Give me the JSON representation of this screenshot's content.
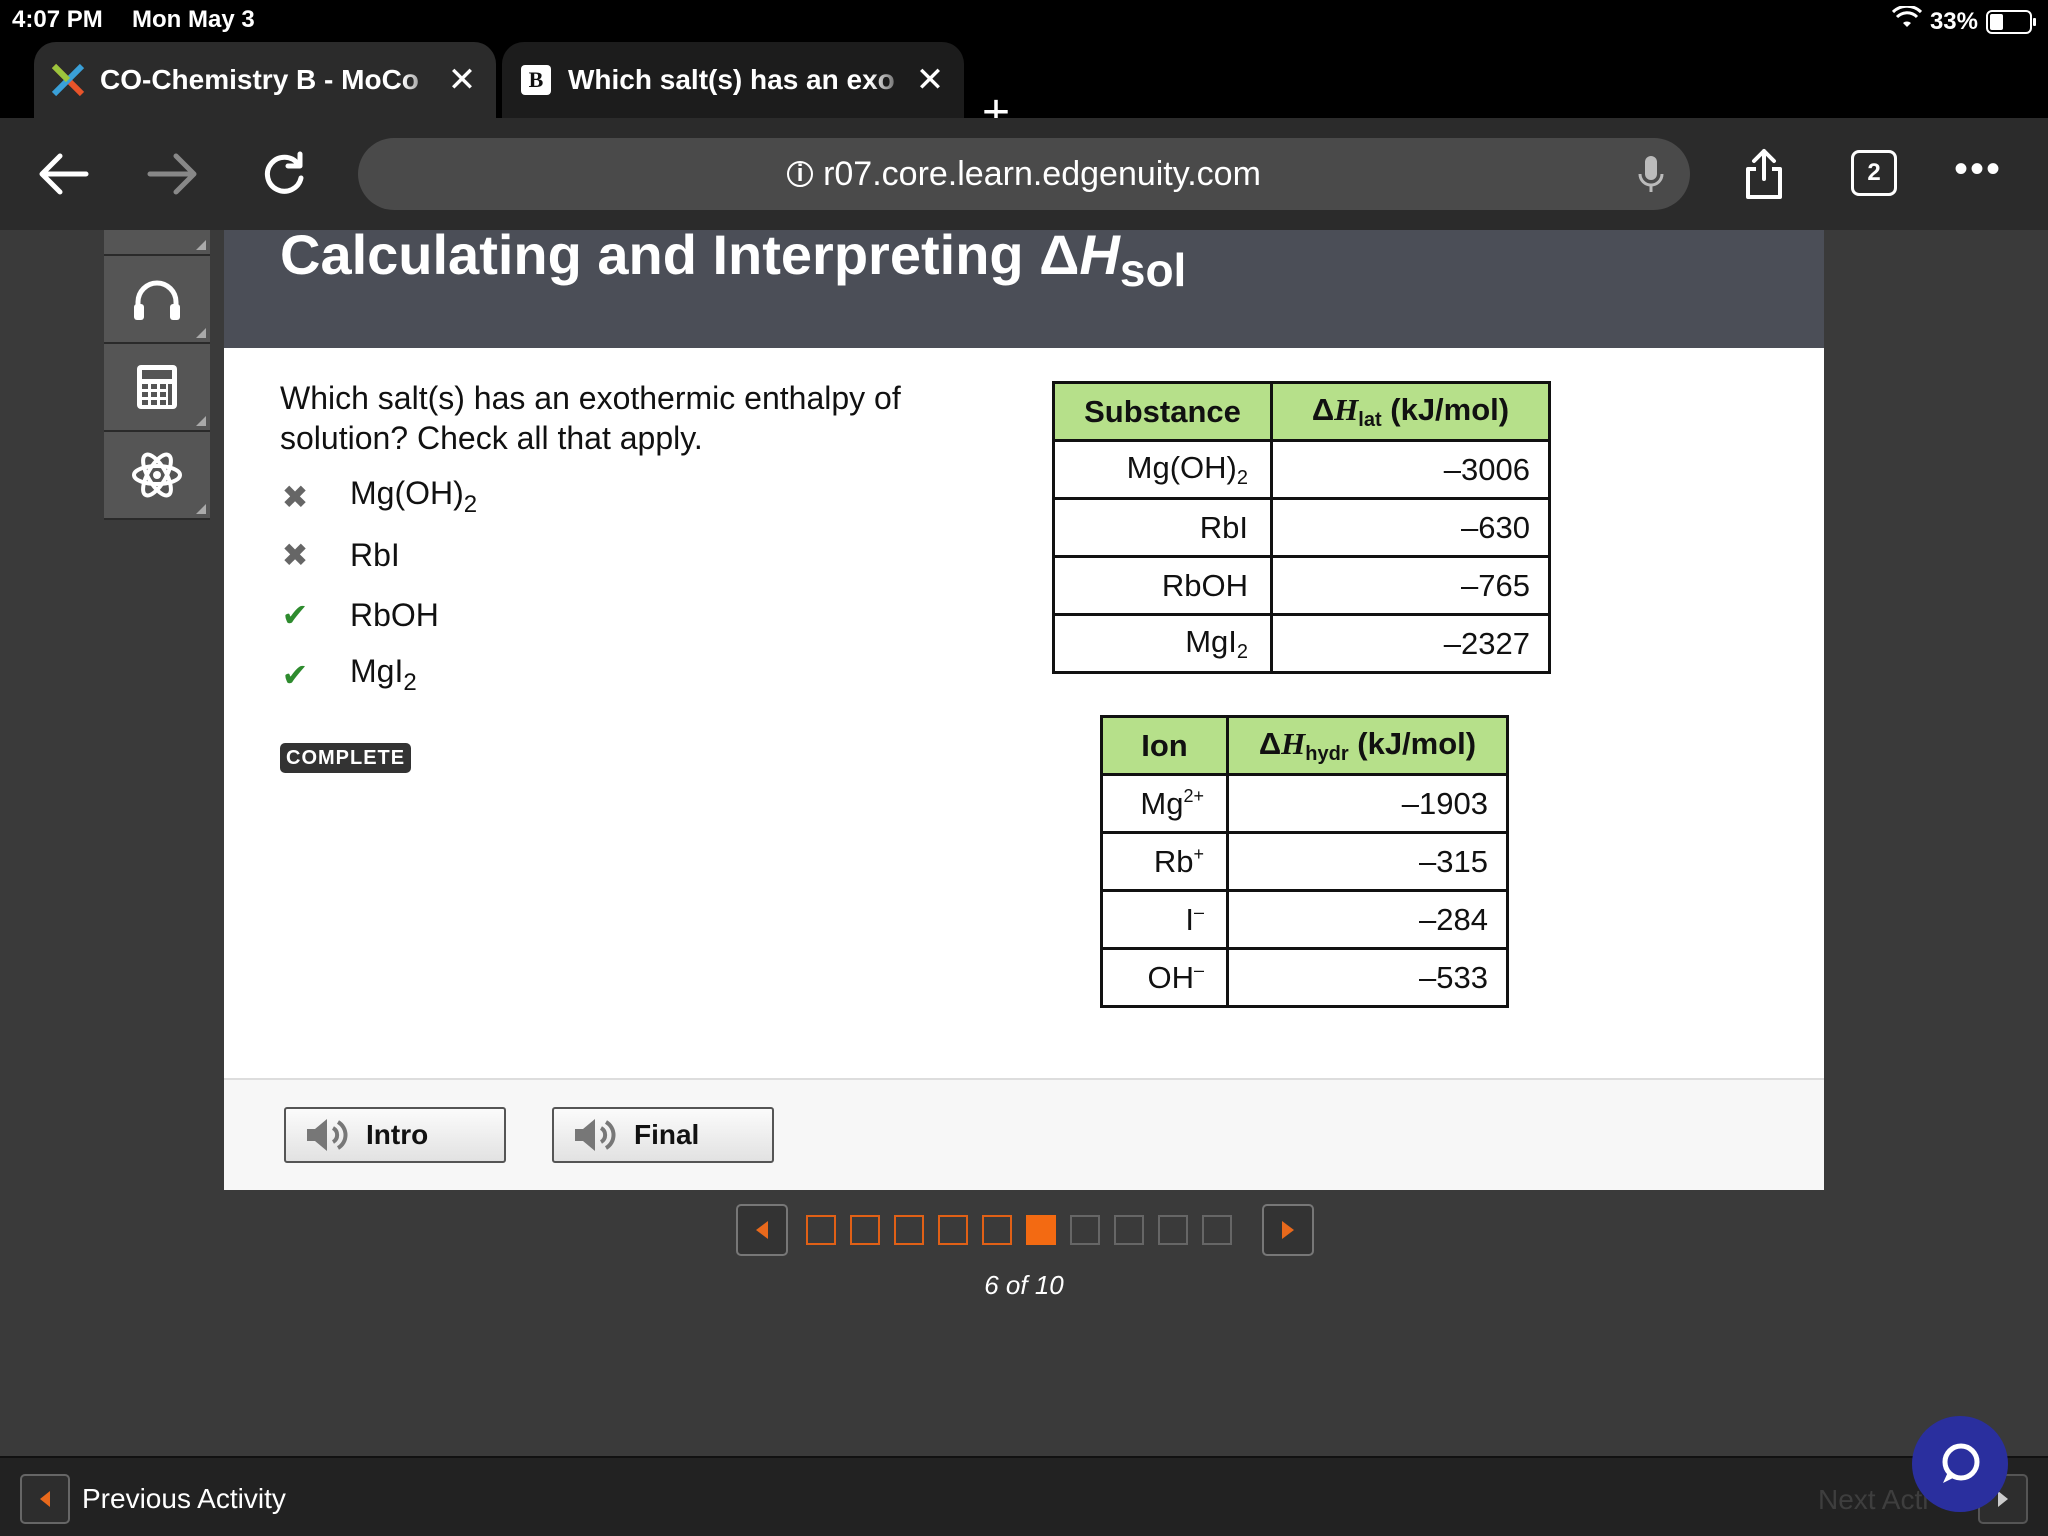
{
  "status_bar": {
    "time": "4:07 PM",
    "date": "Mon May 3",
    "battery": "33%",
    "battery_level": 0.33
  },
  "browser": {
    "tabs": [
      {
        "label": "CO-Chemistry B - MoCo",
        "favicon": "edgenuity-logo-icon",
        "active": true
      },
      {
        "label": "Which salt(s) has an exo",
        "favicon": "brainly-logo-icon",
        "favicon_letter": "B",
        "active": false
      }
    ],
    "new_tab": "+",
    "close": "✕",
    "url": "r07.core.learn.edgenuity.com",
    "tab_count": "2",
    "more": "•••"
  },
  "lesson": {
    "title_main": "Calculating and Interpreting Δ",
    "title_var": "H",
    "title_sub": "sol",
    "question": "Which salt(s) has an exothermic enthalpy of solution? Check all that apply.",
    "options": [
      {
        "base": "Mg(OH)",
        "sub": "2",
        "status": "incorrect",
        "mark": "✖"
      },
      {
        "base": "RbI",
        "sub": "",
        "status": "incorrect",
        "mark": "✖"
      },
      {
        "base": "RbOH",
        "sub": "",
        "status": "correct",
        "mark": "✔"
      },
      {
        "base": "MgI",
        "sub": "2",
        "status": "correct",
        "mark": "✔"
      }
    ],
    "badge": "COMPLETE"
  },
  "lattice_table": {
    "header_col1": "Substance",
    "header_col2_delta": "Δ",
    "header_col2_var": "H",
    "header_col2_sub": "lat",
    "header_col2_unit": " (kJ/mol)",
    "rows": [
      {
        "base": "Mg(OH)",
        "sub": "2",
        "value": "–3006"
      },
      {
        "base": "RbI",
        "sub": "",
        "value": "–630"
      },
      {
        "base": "RbOH",
        "sub": "",
        "value": "–765"
      },
      {
        "base": "MgI",
        "sub": "2",
        "value": "–2327"
      }
    ]
  },
  "hydration_table": {
    "header_col1": "Ion",
    "header_col2_delta": "Δ",
    "header_col2_var": "H",
    "header_col2_sub": "hydr",
    "header_col2_unit": " (kJ/mol)",
    "rows": [
      {
        "base": "Mg",
        "sup": "2+",
        "value": "–1903"
      },
      {
        "base": "Rb",
        "sup": "+",
        "value": "–315"
      },
      {
        "base": "I",
        "sup": "–",
        "value": "–284"
      },
      {
        "base": "OH",
        "sup": "–",
        "value": "–533"
      }
    ]
  },
  "audio_buttons": {
    "intro": "Intro",
    "final": "Final"
  },
  "pager": {
    "total": 10,
    "current": 6,
    "label": "6 of 10"
  },
  "bottom_bar": {
    "previous": "Previous Activity",
    "next": "Next Acti"
  },
  "colors": {
    "table_header": "#b6e08a",
    "correct": "#2e8b2e",
    "current_page": "#f36a12",
    "chat": "#2a2f9e"
  }
}
